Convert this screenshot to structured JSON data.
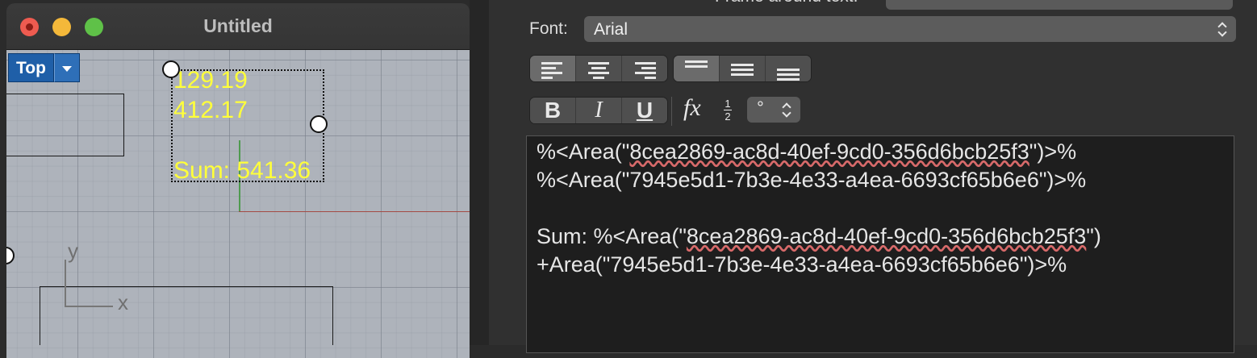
{
  "window": {
    "title": "Untitled"
  },
  "viewport": {
    "view_name": "Top",
    "text_lines": [
      "129.19",
      "412.17",
      "Sum: 541.36"
    ],
    "axis_labels": {
      "y": "y",
      "x": "x"
    }
  },
  "panel": {
    "frame_label": "Frame around text:",
    "font_label": "Font:",
    "font_value": "Arial",
    "style_buttons": {
      "bold": "B",
      "italic": "I",
      "underline": "U"
    },
    "fx_label": "fx",
    "fraction": {
      "num": "1",
      "den": "2"
    },
    "degree_value": "°",
    "editor_lines": {
      "line1": {
        "pre": "%<Area(\"",
        "guid": "8cea2869-ac8d-40ef-9cd0-356d6bcb25f3",
        "post": "\")>%"
      },
      "line2": "%<Area(\"7945e5d1-7b3e-4e33-a4ea-6693cf65b6e6\")>%",
      "line3": {
        "pre": "Sum: %<Area(\"",
        "guid": "8cea2869-ac8d-40ef-9cd0-356d6bcb25f3",
        "post": "\")"
      },
      "line4": "+Area(\"7945e5d1-7b3e-4e33-a4ea-6693cf65b6e6\")>%"
    }
  }
}
